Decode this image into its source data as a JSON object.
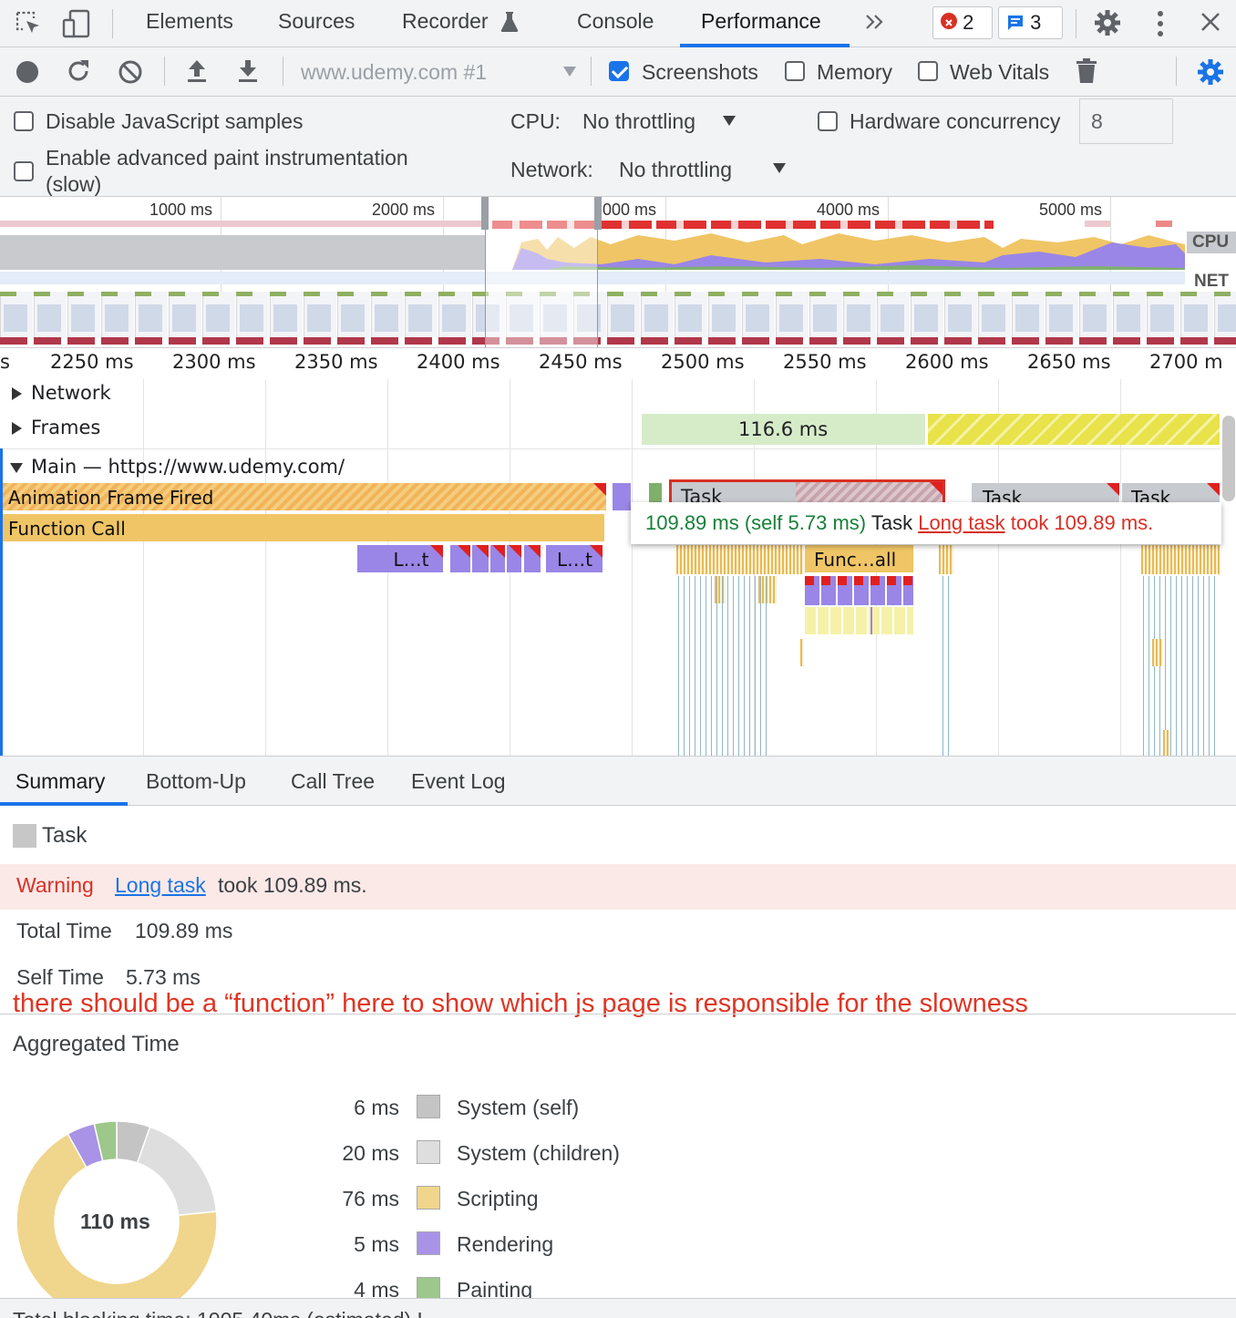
{
  "tabs": {
    "elements": "Elements",
    "sources": "Sources",
    "recorder": "Recorder",
    "console": "Console",
    "performance": "Performance",
    "errors_count": "2",
    "messages_count": "3"
  },
  "toolbar": {
    "profile_select": "www.udemy.com #1",
    "screenshots": "Screenshots",
    "memory": "Memory",
    "web_vitals": "Web Vitals",
    "screenshots_checked": true
  },
  "settings": {
    "disable_js_samples": "Disable JavaScript samples",
    "advanced_paint_line1": "Enable advanced paint instrumentation",
    "advanced_paint_line2": "(slow)",
    "cpu_label": "CPU:",
    "cpu_value": "No throttling",
    "network_label": "Network:",
    "network_value": "No throttling",
    "hardware_concurrency": "Hardware concurrency",
    "hardware_concurrency_value": "8"
  },
  "overview": {
    "ticks": [
      "1000 ms",
      "2000 ms",
      "000 ms",
      "4000 ms",
      "5000 ms"
    ],
    "cpu_label": "CPU",
    "net_label": "NET"
  },
  "ruler": {
    "ticks": [
      "s",
      "2250 ms",
      "2300 ms",
      "2350 ms",
      "2400 ms",
      "2450 ms",
      "2500 ms",
      "2550 ms",
      "2600 ms",
      "2650 ms",
      "2700 m"
    ]
  },
  "flame": {
    "network_track": "Network",
    "frames_track": "Frames",
    "frame_duration": "116.6 ms",
    "main_track": "Main — https://www.udemy.com/",
    "animation_frame_fired": "Animation Frame Fired",
    "function_call": "Function Call",
    "short_lt_1": "L…t",
    "short_lt_2": "L…t",
    "task_1": "Task",
    "task_2": "Task",
    "task_3": "Task",
    "func_all": "Func…all"
  },
  "tooltip": {
    "duration": "109.89 ms (self 5.73 ms)",
    "name": "Task",
    "link": "Long task",
    "suffix": "took 109.89 ms."
  },
  "bottom_tabs": {
    "summary": "Summary",
    "bottom_up": "Bottom-Up",
    "call_tree": "Call Tree",
    "event_log": "Event Log"
  },
  "summary": {
    "title": "Task",
    "warning_label": "Warning",
    "warning_link": "Long task",
    "warning_suffix": "took 109.89 ms.",
    "total_time_label": "Total Time",
    "total_time_value": "109.89 ms",
    "self_time_label": "Self Time",
    "self_time_value": "5.73 ms",
    "annotation": "there should be a “function” here to show which js page is responsible for the slowness",
    "aggregated_title": "Aggregated Time",
    "donut_center": "110 ms",
    "footer_partial": "Total blocking time: 1005.40ms (estimated) L"
  },
  "chart_data": {
    "type": "pie",
    "title": "Aggregated Time",
    "total_label": "110 ms",
    "categories": [
      "System (self)",
      "System (children)",
      "Scripting",
      "Rendering",
      "Painting"
    ],
    "values": [
      6,
      20,
      76,
      5,
      4
    ],
    "value_labels": [
      "6 ms",
      "20 ms",
      "76 ms",
      "5 ms",
      "4 ms"
    ],
    "colors": [
      "#c4c4c4",
      "#dedede",
      "#f0d58c",
      "#a893e6",
      "#9dc78b"
    ]
  }
}
